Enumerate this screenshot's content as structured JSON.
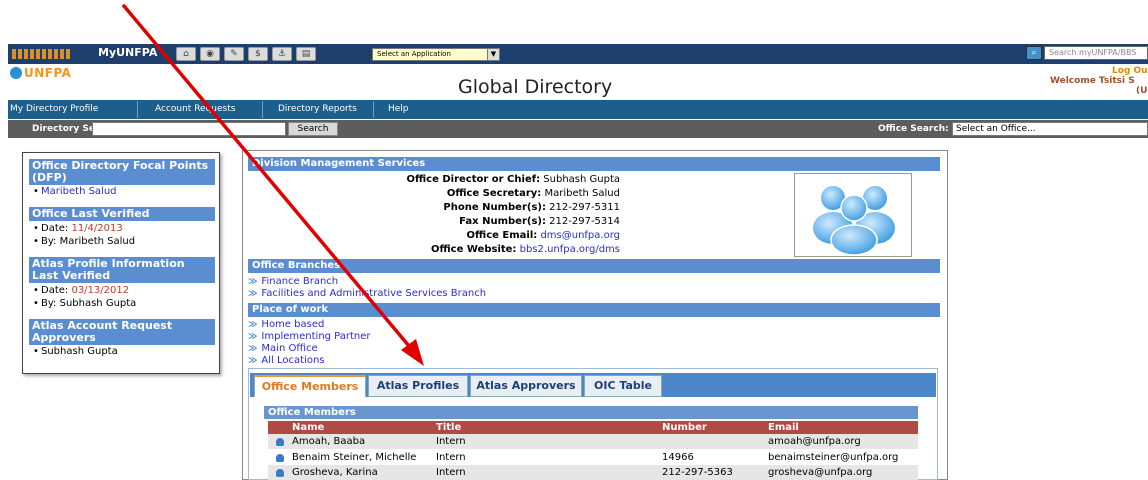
{
  "toolbar": {
    "app_name": "MyUNFPA",
    "app_select": "Select an Application",
    "search_placeholder": "Search myUNFPA/BBS"
  },
  "header": {
    "logo_text": "UNFPA",
    "title": "Global Directory",
    "logout": "Log Ou",
    "welcome": "Welcome Tsitsi S",
    "welcome_sub": "(U"
  },
  "nav": {
    "items": [
      {
        "label": "My Directory Profile"
      },
      {
        "label": "Account Requests"
      },
      {
        "label": "Directory Reports"
      },
      {
        "label": "Help"
      }
    ]
  },
  "searchbar": {
    "directory_label": "Directory Search:",
    "directory_value": "",
    "search_button": "Search",
    "office_label": "Office Search:",
    "office_value": "Select an Office..."
  },
  "left_panel": {
    "dfp_title": "Office Directory Focal Points (DFP)",
    "dfp_name": "Maribeth Salud",
    "verified_title": "Office Last Verified",
    "verified_date_label": "Date: ",
    "verified_date": "11/4/2013",
    "verified_by": "By: Maribeth Salud",
    "atlas_title": "Atlas Profile Information Last Verified",
    "atlas_date_label": "Date: ",
    "atlas_date": "03/13/2012",
    "atlas_by": "By: Subhash Gupta",
    "approvers_title": "Atlas Account Request Approvers",
    "approver": "Subhash Gupta"
  },
  "office": {
    "name": "Division Management Services",
    "director_label": "Office Director or Chief:",
    "director": "Subhash Gupta",
    "secretary_label": "Office Secretary:",
    "secretary": "Maribeth Salud",
    "phone_label": "Phone Number(s):",
    "phone": "212-297-5311",
    "fax_label": "Fax Number(s):",
    "fax": "212-297-5314",
    "email_label": "Office Email:",
    "email": "dms@unfpa.org",
    "website_label": "Office Website:",
    "website": "bbs2.unfpa.org/dms",
    "branches_title": "Office Branches",
    "branches": [
      "Finance Branch",
      "Facilities and Administrative Services Branch"
    ],
    "place_title": "Place of work",
    "places": [
      "Home based",
      "Implementing Partner",
      "Main Office",
      "All Locations"
    ]
  },
  "tabs": [
    {
      "label": "Office Members",
      "active": true
    },
    {
      "label": "Atlas Profiles",
      "active": false
    },
    {
      "label": "Atlas Approvers",
      "active": false
    },
    {
      "label": "OIC Table",
      "active": false
    }
  ],
  "members": {
    "title": "Office Members",
    "columns": [
      "Name",
      "Title",
      "Number",
      "Email"
    ],
    "rows": [
      {
        "name": "Amoah, Baaba",
        "title": "Intern",
        "number": "",
        "email": "amoah@unfpa.org"
      },
      {
        "name": "Benaim Steiner, Michelle",
        "title": "Intern",
        "number": "14966",
        "email": "benaimsteiner@unfpa.org"
      },
      {
        "name": "Grosheva, Karina",
        "title": "Intern",
        "number": "212-297-5363",
        "email": "grosheva@unfpa.org"
      }
    ]
  },
  "colors": {
    "topbar": "#1e3f6b",
    "navbar": "#1c5f8c",
    "section_header": "#5b8ed0",
    "table_header": "#b04a44",
    "active_tab_text": "#e07a1f",
    "annotation_arrow": "#e00000"
  }
}
